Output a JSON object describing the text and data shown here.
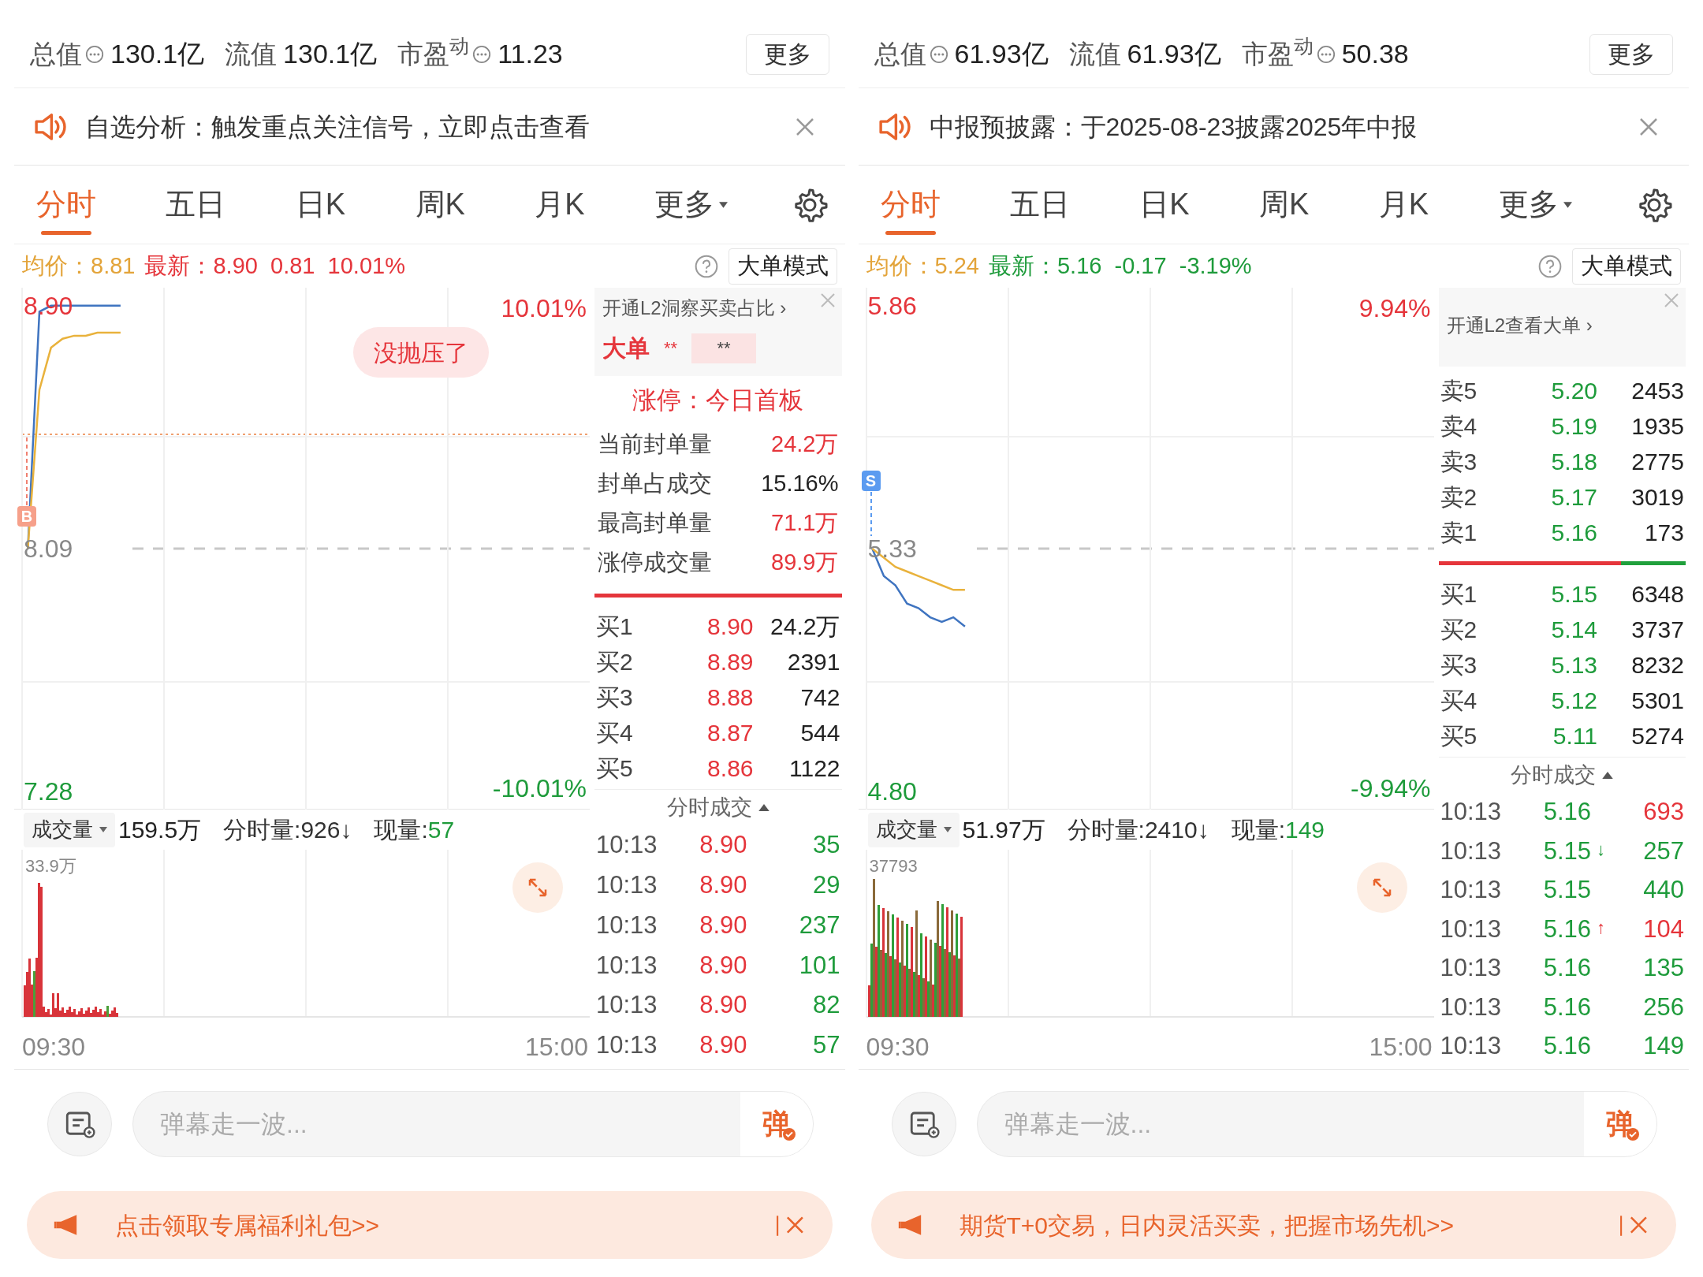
{
  "panels": [
    {
      "stats": [
        {
          "label": "总值",
          "value": "130.1亿",
          "info": true
        },
        {
          "label": "流值",
          "value": "130.1亿",
          "info": false
        },
        {
          "label": "市盈$^{动}$",
          "value": "11.23",
          "info": true
        }
      ],
      "more_button": "更多",
      "notice": "自选分析：触发重点关注信号，立即点击查看",
      "tabs": [
        {
          "label": "分时",
          "selected": true,
          "kind": "plain"
        },
        {
          "label": "五日",
          "selected": false,
          "kind": "plain"
        },
        {
          "label": "日K",
          "selected": false,
          "kind": "plain"
        },
        {
          "label": "周K",
          "selected": false,
          "kind": "plain"
        },
        {
          "label": "月K",
          "selected": false,
          "kind": "plain"
        },
        {
          "label": "更多",
          "selected": false,
          "kind": "dropdown"
        }
      ],
      "summary": {
        "avg_label": "均价：",
        "avg": "8.81",
        "latest_label": "最新：",
        "latest": "8.90",
        "change": "0.81",
        "pct": "10.01%",
        "color": "#e5353b"
      },
      "mode_button": "大单模式",
      "chart": {
        "kind": "limit_up",
        "top_pct": "10.01%",
        "bottom_pct": "-10.01%",
        "signal": {
          "text": "B",
          "kind": "buy"
        },
        "badge": "没抛压了",
        "chart_data": {
          "type": "line",
          "categories": [
            null,
            null,
            null,
            null,
            null,
            null,
            null,
            null,
            null,
            null,
            null,
            null,
            null,
            null,
            null,
            null,
            null,
            null,
            null,
            null,
            null,
            null,
            null,
            null,
            null,
            null,
            null,
            null,
            null,
            null,
            null,
            null,
            null,
            null,
            null,
            null,
            null,
            null,
            null,
            null,
            null,
            null,
            null,
            null,
            null,
            null,
            null,
            null,
            null
          ],
          "series": [
            {
              "color": "#3f74c0",
              "values": [
                8.09,
                8.88,
                8.9,
                8.9,
                8.9,
                8.9,
                8.9,
                8.9,
                8.9,
                null,
                null,
                null,
                null,
                null,
                null,
                null,
                null,
                null,
                null,
                null,
                null,
                null,
                null,
                null,
                null,
                null,
                null,
                null,
                null,
                null,
                null,
                null,
                null,
                null,
                null,
                null,
                null,
                null,
                null,
                null,
                null,
                null,
                null,
                null,
                null,
                null,
                null,
                null,
                null
              ]
            },
            {
              "color": "#e9b23c",
              "values": [
                8.09,
                8.62,
                8.76,
                8.79,
                8.8,
                8.8,
                8.81,
                8.81,
                8.81,
                null,
                null,
                null,
                null,
                null,
                null,
                null,
                null,
                null,
                null,
                null,
                null,
                null,
                null,
                null,
                null,
                null,
                null,
                null,
                null,
                null,
                null,
                null,
                null,
                null,
                null,
                null,
                null,
                null,
                null,
                null,
                null,
                null,
                null,
                null,
                null,
                null,
                null,
                null,
                null
              ]
            }
          ],
          "ylim": [
            7.22,
            8.96
          ],
          "yticks": [
            {
              "value": 8.9,
              "label": "8.90"
            },
            {
              "value": 8.09,
              "label": "8.09"
            },
            {
              "value": 7.28,
              "label": "7.28"
            }
          ]
        }
      },
      "volume": {
        "kind": "limit_up",
        "selector": "成交量",
        "total": "159.5万",
        "minute_label": "分时量:926↓",
        "current_label": "现量:",
        "current": "57",
        "max": "33.9万",
        "start_time": "09:30",
        "end_time": "15:00"
      },
      "order_book": {
        "promo": "开通L2洞察买卖占比 ›",
        "big_order": {
          "label": "大单",
          "value": "**",
          "box": "**"
        },
        "limit_up": {
          "title": "涨停：今日首板",
          "rows": [
            {
              "label": "当前封单量",
              "value": "24.2万",
              "color": "#e5353b"
            },
            {
              "label": "封单占成交",
              "value": "15.16%",
              "color": "#222222"
            },
            {
              "label": "最高封单量",
              "value": "71.1万",
              "color": "#e5353b"
            },
            {
              "label": "涨停成交量",
              "value": "89.9万",
              "color": "#e5353b"
            }
          ]
        },
        "ratio": {
          "level": 1
        },
        "bids": [
          {
            "label": "买1",
            "price": "8.90",
            "qty": "24.2万",
            "color": "#e5353b"
          },
          {
            "label": "买2",
            "price": "8.89",
            "qty": "2391",
            "color": "#e5353b"
          },
          {
            "label": "买3",
            "price": "8.88",
            "qty": "742",
            "color": "#e5353b"
          },
          {
            "label": "买4",
            "price": "8.87",
            "qty": "544",
            "color": "#e5353b"
          },
          {
            "label": "买5",
            "price": "8.86",
            "qty": "1122",
            "color": "#e5353b"
          }
        ],
        "trades_title": "分时成交",
        "trades": [
          {
            "time": "10:13",
            "price": {
              "text": "8.90",
              "color": "#e5353b"
            },
            "qty": {
              "text": "35",
              "color": "#1e9b3b"
            }
          },
          {
            "time": "10:13",
            "price": {
              "text": "8.90",
              "color": "#e5353b"
            },
            "qty": {
              "text": "29",
              "color": "#1e9b3b"
            }
          },
          {
            "time": "10:13",
            "price": {
              "text": "8.90",
              "color": "#e5353b"
            },
            "qty": {
              "text": "237",
              "color": "#1e9b3b"
            }
          },
          {
            "time": "10:13",
            "price": {
              "text": "8.90",
              "color": "#e5353b"
            },
            "qty": {
              "text": "101",
              "color": "#1e9b3b"
            }
          },
          {
            "time": "10:13",
            "price": {
              "text": "8.90",
              "color": "#e5353b"
            },
            "qty": {
              "text": "82",
              "color": "#1e9b3b"
            }
          },
          {
            "time": "10:13",
            "price": {
              "text": "8.90",
              "color": "#e5353b"
            },
            "qty": {
              "text": "57",
              "color": "#1e9b3b"
            }
          }
        ]
      },
      "chat": {
        "placeholder": "弹幕走一波...",
        "send": "弹"
      },
      "banner": "点击领取专属福利礼包>>"
    },
    {
      "stats": [
        {
          "label": "总值",
          "value": "61.93亿",
          "info": true
        },
        {
          "label": "流值",
          "value": "61.93亿",
          "info": false
        },
        {
          "label": "市盈$^{动}$",
          "value": "50.38",
          "info": true
        }
      ],
      "more_button": "更多",
      "notice": "中报预披露：于2025-08-23披露2025年中报",
      "tabs": [
        {
          "label": "分时",
          "selected": true,
          "kind": "plain"
        },
        {
          "label": "五日",
          "selected": false,
          "kind": "plain"
        },
        {
          "label": "日K",
          "selected": false,
          "kind": "plain"
        },
        {
          "label": "周K",
          "selected": false,
          "kind": "plain"
        },
        {
          "label": "月K",
          "selected": false,
          "kind": "plain"
        },
        {
          "label": "更多",
          "selected": false,
          "kind": "dropdown"
        }
      ],
      "summary": {
        "avg_label": "均价：",
        "avg": "5.24",
        "latest_label": "最新：",
        "latest": "5.16",
        "change": "-0.17",
        "pct": "-3.19%",
        "color": "#1e9b3b"
      },
      "mode_button": "大单模式",
      "chart": {
        "kind": "falling",
        "top_pct": "9.94%",
        "bottom_pct": "-9.94%",
        "signal": {
          "text": "S",
          "kind": "sell"
        },
        "chart_data": {
          "type": "line",
          "categories": [
            null,
            null,
            null,
            null,
            null,
            null,
            null,
            null,
            null,
            null,
            null,
            null,
            null,
            null,
            null,
            null,
            null,
            null,
            null,
            null,
            null,
            null,
            null,
            null,
            null,
            null,
            null,
            null,
            null,
            null,
            null,
            null,
            null,
            null,
            null,
            null,
            null,
            null,
            null,
            null,
            null,
            null,
            null,
            null,
            null,
            null,
            null,
            null,
            null
          ],
          "series": [
            {
              "color": "#3f74c0",
              "values": [
                5.33,
                5.27,
                5.25,
                5.21,
                5.2,
                5.18,
                5.17,
                5.18,
                5.16,
                null,
                null,
                null,
                null,
                null,
                null,
                null,
                null,
                null,
                null,
                null,
                null,
                null,
                null,
                null,
                null,
                null,
                null,
                null,
                null,
                null,
                null,
                null,
                null,
                null,
                null,
                null,
                null,
                null,
                null,
                null,
                null,
                null,
                null,
                null,
                null,
                null,
                null,
                null,
                null
              ]
            },
            {
              "color": "#e9b23c",
              "values": [
                5.33,
                5.31,
                5.29,
                5.28,
                5.27,
                5.26,
                5.25,
                5.24,
                5.24,
                null,
                null,
                null,
                null,
                null,
                null,
                null,
                null,
                null,
                null,
                null,
                null,
                null,
                null,
                null,
                null,
                null,
                null,
                null,
                null,
                null,
                null,
                null,
                null,
                null,
                null,
                null,
                null,
                null,
                null,
                null,
                null,
                null,
                null,
                null,
                null,
                null,
                null,
                null,
                null
              ]
            }
          ],
          "ylim": [
            4.76,
            5.9
          ],
          "yticks": [
            {
              "value": 5.86,
              "label": "5.86"
            },
            {
              "value": 5.33,
              "label": "5.33"
            },
            {
              "value": 4.8,
              "label": "4.80"
            }
          ]
        }
      },
      "volume": {
        "kind": "falling",
        "selector": "成交量",
        "total": "51.97万",
        "minute_label": "分时量:2410↓",
        "current_label": "现量:",
        "current": "149",
        "max": "37793",
        "start_time": "09:30",
        "end_time": "15:00"
      },
      "order_book": {
        "promo": "开通L2查看大单 ›",
        "asks": [
          {
            "label": "卖5",
            "price": "5.20",
            "qty": "2453",
            "color": "#1e9b3b"
          },
          {
            "label": "卖4",
            "price": "5.19",
            "qty": "1935",
            "color": "#1e9b3b"
          },
          {
            "label": "卖3",
            "price": "5.18",
            "qty": "2775",
            "color": "#1e9b3b"
          },
          {
            "label": "卖2",
            "price": "5.17",
            "qty": "3019",
            "color": "#1e9b3b"
          },
          {
            "label": "卖1",
            "price": "5.16",
            "qty": "173",
            "color": "#1e9b3b"
          }
        ],
        "ratio": {
          "level": 0.74
        },
        "bids": [
          {
            "label": "买1",
            "price": "5.15",
            "qty": "6348",
            "color": "#1e9b3b"
          },
          {
            "label": "买2",
            "price": "5.14",
            "qty": "3737",
            "color": "#1e9b3b"
          },
          {
            "label": "买3",
            "price": "5.13",
            "qty": "8232",
            "color": "#1e9b3b"
          },
          {
            "label": "买4",
            "price": "5.12",
            "qty": "5301",
            "color": "#1e9b3b"
          },
          {
            "label": "买5",
            "price": "5.11",
            "qty": "5274",
            "color": "#1e9b3b"
          }
        ],
        "trades_title": "分时成交",
        "trades": [
          {
            "time": "10:13",
            "price": {
              "text": "5.16",
              "color": "#1e9b3b"
            },
            "qty": {
              "text": "693",
              "color": "#e5353b"
            }
          },
          {
            "time": "10:13",
            "price": {
              "text": "5.15",
              "color": "#1e9b3b"
            },
            "arrow": {
              "text": "↓",
              "color": "#1e9b3b"
            },
            "qty": {
              "text": "257",
              "color": "#1e9b3b"
            }
          },
          {
            "time": "10:13",
            "price": {
              "text": "5.15",
              "color": "#1e9b3b"
            },
            "qty": {
              "text": "440",
              "color": "#1e9b3b"
            }
          },
          {
            "time": "10:13",
            "price": {
              "text": "5.16",
              "color": "#1e9b3b"
            },
            "arrow": {
              "text": "↑",
              "color": "#e5353b"
            },
            "qty": {
              "text": "104",
              "color": "#e5353b"
            }
          },
          {
            "time": "10:13",
            "price": {
              "text": "5.16",
              "color": "#1e9b3b"
            },
            "qty": {
              "text": "135",
              "color": "#1e9b3b"
            }
          },
          {
            "time": "10:13",
            "price": {
              "text": "5.16",
              "color": "#1e9b3b"
            },
            "qty": {
              "text": "256",
              "color": "#1e9b3b"
            }
          },
          {
            "time": "10:13",
            "price": {
              "text": "5.16",
              "color": "#1e9b3b"
            },
            "qty": {
              "text": "149",
              "color": "#1e9b3b"
            }
          }
        ]
      },
      "chat": {
        "placeholder": "弹幕走一波...",
        "send": "弹"
      },
      "banner": "期货T+0交易，日内灵活买卖，把握市场先机>>"
    }
  ]
}
